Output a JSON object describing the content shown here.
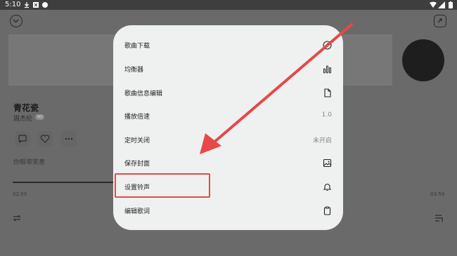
{
  "status_bar": {
    "time": "5:10"
  },
  "player": {
    "song_title": "青花瓷",
    "artist": "周杰伦",
    "badge": "SQ",
    "lyric": "你眼带笑意",
    "time_elapsed": "02:59",
    "time_total": "03:59"
  },
  "menu": {
    "items": [
      {
        "label": "歌曲下载",
        "icon": "download-icon"
      },
      {
        "label": "均衡器",
        "icon": "equalizer-icon"
      },
      {
        "label": "歌曲信息编辑",
        "icon": "file-icon"
      },
      {
        "label": "播放倍速",
        "value": "1.0"
      },
      {
        "label": "定时关闭",
        "value": "未开启"
      },
      {
        "label": "保存封面",
        "icon": "image-icon"
      },
      {
        "label": "设置铃声",
        "icon": "bell-icon"
      },
      {
        "label": "编辑歌词",
        "icon": "clipboard-icon"
      }
    ]
  },
  "annotation": {
    "color": "#e74848"
  }
}
